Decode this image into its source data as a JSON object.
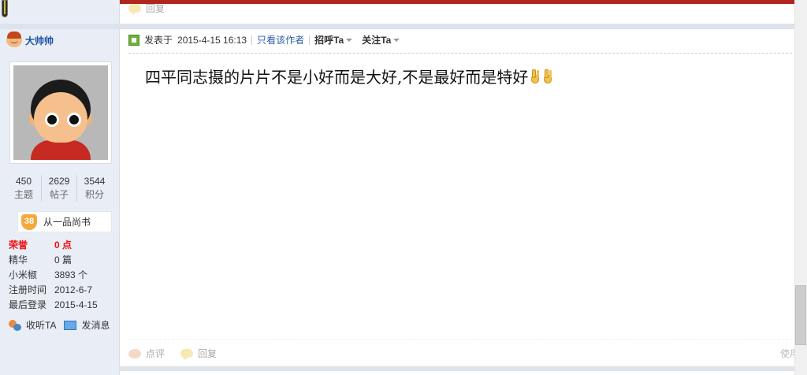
{
  "previous_post": {
    "reply_label": "回复"
  },
  "author": {
    "name": "大帅帅",
    "stats": [
      {
        "value": "450",
        "label": "主题"
      },
      {
        "value": "2629",
        "label": "帖子"
      },
      {
        "value": "3544",
        "label": "积分"
      }
    ],
    "rank_level": "38",
    "rank_title": "从一品尚书",
    "info": [
      {
        "key": "荣誉",
        "value": "0 点",
        "highlight": true
      },
      {
        "key": "精华",
        "value": "0 篇"
      },
      {
        "key": "小米椒",
        "value": "3893 个"
      },
      {
        "key": "注册时间",
        "value": "2012-6-7"
      },
      {
        "key": "最后登录",
        "value": "2015-4-15"
      }
    ],
    "actions": {
      "listen": "收听TA",
      "message": "发消息"
    }
  },
  "post": {
    "posted_label": "发表于",
    "date": "2015-4-15 16:13",
    "only_author": "只看该作者",
    "greet": "招呼Ta",
    "follow": "关注Ta",
    "body": "四平同志摄的片片不是小好而是大好,不是最好而是特好",
    "emoji_count": 2
  },
  "footer": {
    "rate": "点评",
    "reply": "回复",
    "use": "使用"
  },
  "colors": {
    "accent_red": "#b1251f",
    "link_blue": "#2a5daa",
    "sidebar_bg": "#e9eef6"
  }
}
